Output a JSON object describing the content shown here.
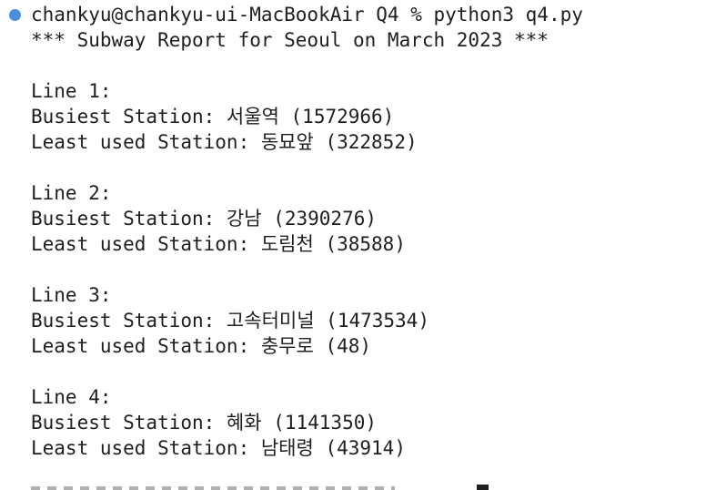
{
  "prompt": {
    "text": "chankyu@chankyu-ui-MacBookAir Q4 % python3 q4.py",
    "status_color": "#4a8fdc"
  },
  "report": {
    "header": "*** Subway Report for Seoul on March 2023 ***",
    "lines": [
      {
        "title": "Line 1:",
        "busiest": "Busiest Station: 서울역 (1572966)",
        "least": "Least used Station: 동묘앞 (322852)"
      },
      {
        "title": "Line 2:",
        "busiest": "Busiest Station: 강남 (2390276)",
        "least": "Least used Station: 도림천 (38588)"
      },
      {
        "title": "Line 3:",
        "busiest": "Busiest Station: 고속터미널 (1473534)",
        "least": "Least used Station: 충무로 (48)"
      },
      {
        "title": "Line 4:",
        "busiest": "Busiest Station: 혜화 (1141350)",
        "least": "Least used Station: 남태령 (43914)"
      }
    ]
  }
}
